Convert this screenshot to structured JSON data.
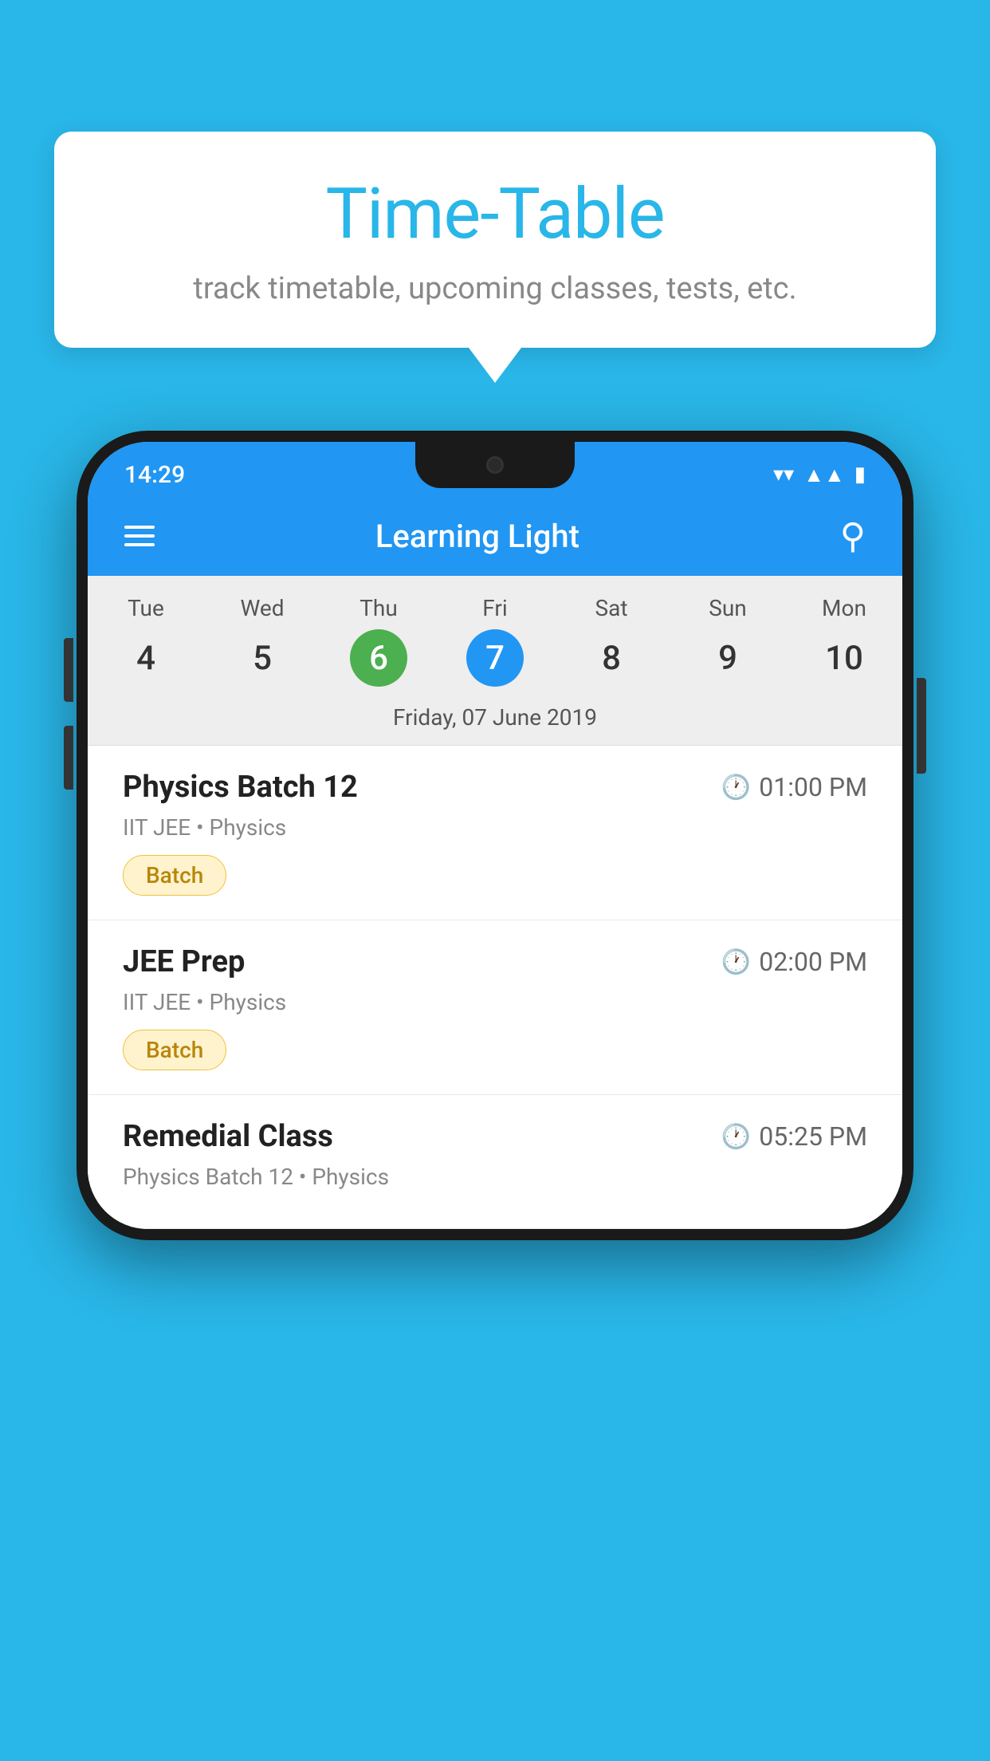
{
  "background_color": "#29b6e8",
  "bubble": {
    "title": "Time-Table",
    "subtitle": "track timetable, upcoming classes, tests, etc."
  },
  "phone": {
    "status_bar": {
      "time": "14:29"
    },
    "app_bar": {
      "title": "Learning Light"
    },
    "calendar": {
      "days": [
        {
          "name": "Tue",
          "num": "4",
          "state": "normal"
        },
        {
          "name": "Wed",
          "num": "5",
          "state": "normal"
        },
        {
          "name": "Thu",
          "num": "6",
          "state": "today"
        },
        {
          "name": "Fri",
          "num": "7",
          "state": "selected"
        },
        {
          "name": "Sat",
          "num": "8",
          "state": "normal"
        },
        {
          "name": "Sun",
          "num": "9",
          "state": "normal"
        },
        {
          "name": "Mon",
          "num": "10",
          "state": "normal"
        }
      ],
      "selected_date_label": "Friday, 07 June 2019"
    },
    "schedule": [
      {
        "name": "Physics Batch 12",
        "time": "01:00 PM",
        "sub": "IIT JEE • Physics",
        "badge": "Batch"
      },
      {
        "name": "JEE Prep",
        "time": "02:00 PM",
        "sub": "IIT JEE • Physics",
        "badge": "Batch"
      },
      {
        "name": "Remedial Class",
        "time": "05:25 PM",
        "sub": "Physics Batch 12 • Physics",
        "badge": null
      }
    ]
  }
}
